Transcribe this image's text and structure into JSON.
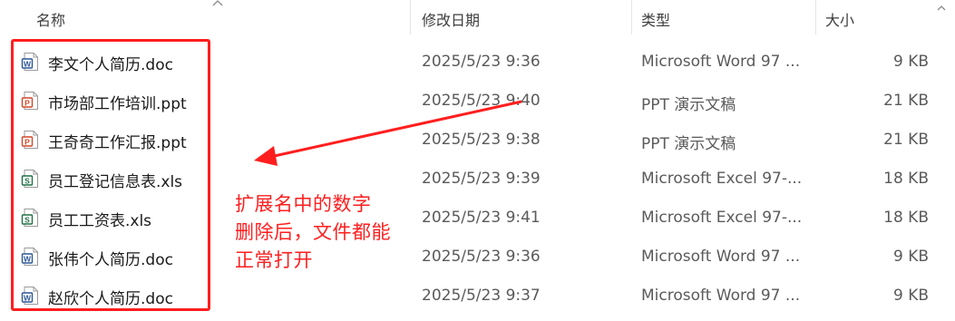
{
  "columns": {
    "name": "名称",
    "modified": "修改日期",
    "type": "类型",
    "size": "大小"
  },
  "files": [
    {
      "name": "李文个人简历.doc",
      "modified": "2025/5/23 9:36",
      "type": "Microsoft Word 97 ...",
      "size": "9 KB",
      "icon": "word-doc-icon",
      "letter": "W",
      "color": "#2b5797"
    },
    {
      "name": "市场部工作培训.ppt",
      "modified": "2025/5/23 9:40",
      "type": "PPT 演示文稿",
      "size": "21 KB",
      "icon": "ppt-icon",
      "letter": "P",
      "color": "#d24726"
    },
    {
      "name": "王奇奇工作汇报.ppt",
      "modified": "2025/5/23 9:38",
      "type": "PPT 演示文稿",
      "size": "21 KB",
      "icon": "ppt-icon",
      "letter": "P",
      "color": "#d24726"
    },
    {
      "name": "员工登记信息表.xls",
      "modified": "2025/5/23 9:39",
      "type": "Microsoft Excel 97-...",
      "size": "18 KB",
      "icon": "excel-icon",
      "letter": "S",
      "color": "#1e7145"
    },
    {
      "name": "员工工资表.xls",
      "modified": "2025/5/23 9:41",
      "type": "Microsoft Excel 97-...",
      "size": "18 KB",
      "icon": "excel-icon",
      "letter": "S",
      "color": "#1e7145"
    },
    {
      "name": "张伟个人简历.doc",
      "modified": "2025/5/23 9:36",
      "type": "Microsoft Word 97 ...",
      "size": "9 KB",
      "icon": "word-doc-icon",
      "letter": "W",
      "color": "#2b5797"
    },
    {
      "name": "赵欣个人简历.doc",
      "modified": "2025/5/23 9:37",
      "type": "Microsoft Word 97 ...",
      "size": "9 KB",
      "icon": "word-doc-icon",
      "letter": "W",
      "color": "#2b5797"
    }
  ],
  "annotation": {
    "lines": [
      "扩展名中的数字",
      "删除后，文件都能",
      "正常打开"
    ],
    "color": "#ff1e1e"
  }
}
